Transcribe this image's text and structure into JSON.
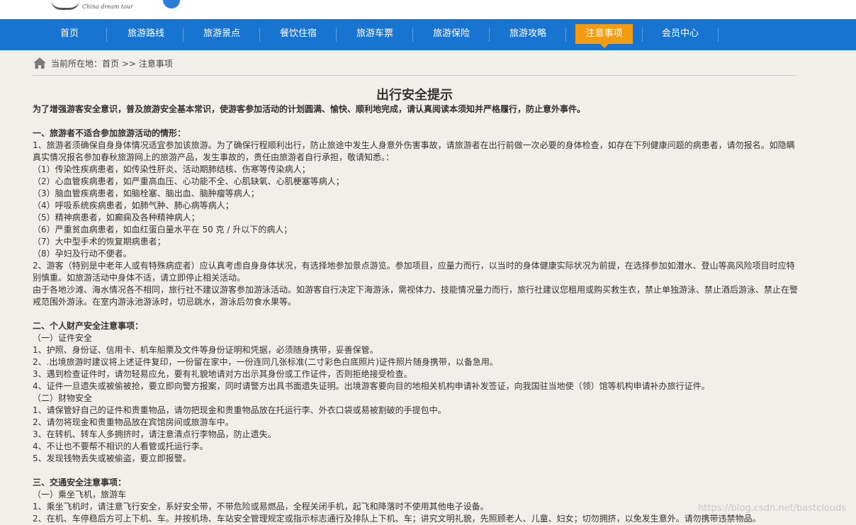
{
  "logo": {
    "tagline": "China dream tour"
  },
  "nav": {
    "items": [
      {
        "label": "首页"
      },
      {
        "label": "旅游路线"
      },
      {
        "label": "旅游景点"
      },
      {
        "label": "餐饮住宿"
      },
      {
        "label": "旅游车票"
      },
      {
        "label": "旅游保险"
      },
      {
        "label": "旅游攻略"
      },
      {
        "label": "注意事项",
        "active": true
      },
      {
        "label": "会员中心"
      }
    ]
  },
  "breadcrumb": {
    "text": "当前所在地：首页 >> 注意事项"
  },
  "article": {
    "title": "出行安全提示",
    "intro": "为了增强游客安全意识，普及旅游安全基本常识，使游客参加活动的计划圆满、愉快、顺利地完成，请认真阅读本须知并严格履行，防止意外事件。",
    "s1": {
      "heading": "一、旅游者不适合参加旅游活动的情形：",
      "p1": "1、旅游者须确保自身身体情况适宜参加该旅游。为了确保行程顺利出行，防止旅途中发生人身意外伤害事故，请旅游者在出行前做一次必要的身体检查，如存在下列健康问题的病患者，请勿报名。如隐瞒真实情况报名参加春秋旅游网上的旅游产品，发生事故的，责任由旅游者自行承担，敬请知悉。：",
      "i1": "（1）传染性疾病患者，如传染性肝炎、活动期肺结核、伤寒等传染病人；",
      "i2": "（2）心血管疾病患者，如严重高血压、心功能不全、心肌缺氧、心肌梗塞等病人；",
      "i3": "（3）脑血管疾病患者，如脑栓塞、脑出血、脑肿瘤等病人；",
      "i4": "（4）呼吸系统疾病患者，如肺气肿、肺心病等病人；",
      "i5": "（5）精神病患者，如癫痫及各种精神病人；",
      "i6": "（6）严重贫血病患者，如血红蛋白量水平在 50 克 / 升以下的病人；",
      "i7": "（7）大中型手术的恢复期病患者；",
      "i8": "（8）孕妇及行动不便者。",
      "p2": "2、游客（特别是中老年人或有特殊病症者）应认真考虑自身身体状况，有选择地参加景点游览。参加项目，应量力而行，以当时的身体健康实际状况为前提，在选择参加如潜水、登山等高风险项目时应特别慎重。如旅游活动中身体不适，请立即停止相关活动。",
      "p3": "由于各地沙滩、海水情况各不相同，旅行社不建议游客参加游泳活动。如游客自行决定下海游泳，需视体力、技能情况量力而行，旅行社建议您租用或购买救生衣，禁止单独游泳、禁止酒后游泳、禁止在警戒范围外游泳。在室内游泳池游泳时，切忌跳水，游泳后勿食水果等。"
    },
    "s2": {
      "heading": "二、个人财产安全注意事项：",
      "sub1": "（一）证件安全",
      "a1": "1、护照、身份证、信用卡、机车船票及文件等身份证明和凭据，必须随身携带，妥善保管。",
      "a2": "2、.出境旅游时建议将上述证件复印，一份留在家中，一份连同几张标准(二寸彩色白底照片)证件照片随身携带，以备急用。",
      "a3": "3、遇到检查证件时，请勿轻易应允，要有礼貌地请对方出示其身份或工作证件，否则拒绝接受检查。",
      "a4": "4、证件一旦遗失或被偷被抢，要立即向警方报案，同时请警方出具书面遗失证明。出境游客要向目的地相关机构申请补发签证，向我国驻当地使（领）馆等机构申请补办旅行证件。",
      "sub2": "（二）财物安全",
      "b1": "1、请保管好自己的证件和贵重物品，请勿把现金和贵重物品放在托运行李、外衣口袋或易被割破的手提包中。",
      "b2": "2、请勿将现金和贵重物品放在宾馆房间或旅游车中。",
      "b3": "3、在转机、转车人多拥挤时，请注意清点行李物品，防止遗失。",
      "b4": "4、不让也不要帮不相识的人看管或托运行李。",
      "b5": "5、发现钱物丢失或被偷盗，要立即报警。"
    },
    "s3": {
      "heading": "三、交通安全注意事项：",
      "sub1": "（一）乘坐飞机，旅游车",
      "c1": "1、乘坐飞机时，请注意飞行安全，系好安全带，不带危险或易燃品，全程关闭手机，起飞和降落时不使用其他电子设备。",
      "c2": "2、在机、车停稳后方可上下机、车。并按机场、车站安全管理规定或指示标志通行及排队上下机、车；讲究文明礼貌，先照顾老人、儿童、妇女；切勿拥挤，以免发生意外。请勿携带违禁物品。"
    }
  },
  "watermark": "https://blog.csdn.net/bastclouds"
}
